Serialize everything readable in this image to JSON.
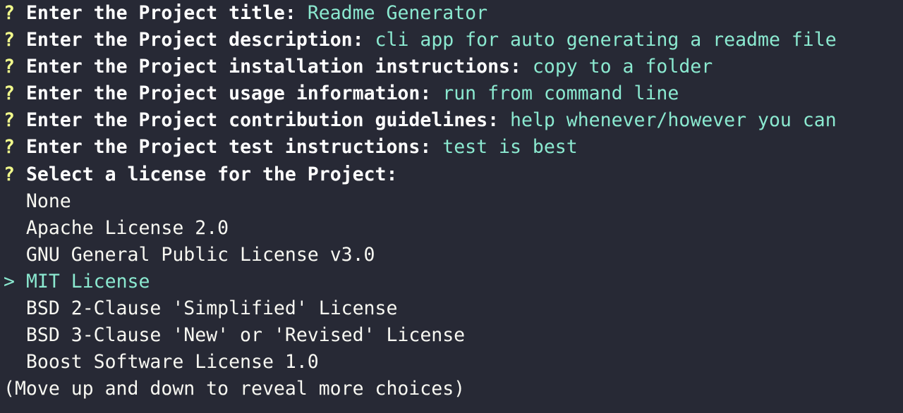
{
  "colors": {
    "background": "#272935",
    "question_mark": "#f1fa8c",
    "answer": "#8be9d0",
    "text": "#f8f8f2"
  },
  "questions": [
    {
      "marker": "?",
      "prompt": "Enter the Project title:",
      "answer": "Readme Generator"
    },
    {
      "marker": "?",
      "prompt": "Enter the Project description:",
      "answer": "cli app for auto generating a readme file"
    },
    {
      "marker": "?",
      "prompt": "Enter the Project installation instructions:",
      "answer": "copy to a folder"
    },
    {
      "marker": "?",
      "prompt": "Enter the Project usage information:",
      "answer": "run from command line"
    },
    {
      "marker": "?",
      "prompt": "Enter the Project contribution guidelines:",
      "answer": "help whenever/however you can"
    },
    {
      "marker": "?",
      "prompt": "Enter the Project test instructions:",
      "answer": "test is best"
    }
  ],
  "license_question": {
    "marker": "?",
    "prompt": "Select a license for the Project:"
  },
  "pointer": ">",
  "choices": [
    {
      "label": "None",
      "selected": false
    },
    {
      "label": "Apache License 2.0",
      "selected": false
    },
    {
      "label": "GNU General Public License v3.0",
      "selected": false
    },
    {
      "label": "MIT License",
      "selected": true
    },
    {
      "label": "BSD 2-Clause 'Simplified' License",
      "selected": false
    },
    {
      "label": "BSD 3-Clause 'New' or 'Revised' License",
      "selected": false
    },
    {
      "label": "Boost Software License 1.0",
      "selected": false
    }
  ],
  "hint": "(Move up and down to reveal more choices)"
}
